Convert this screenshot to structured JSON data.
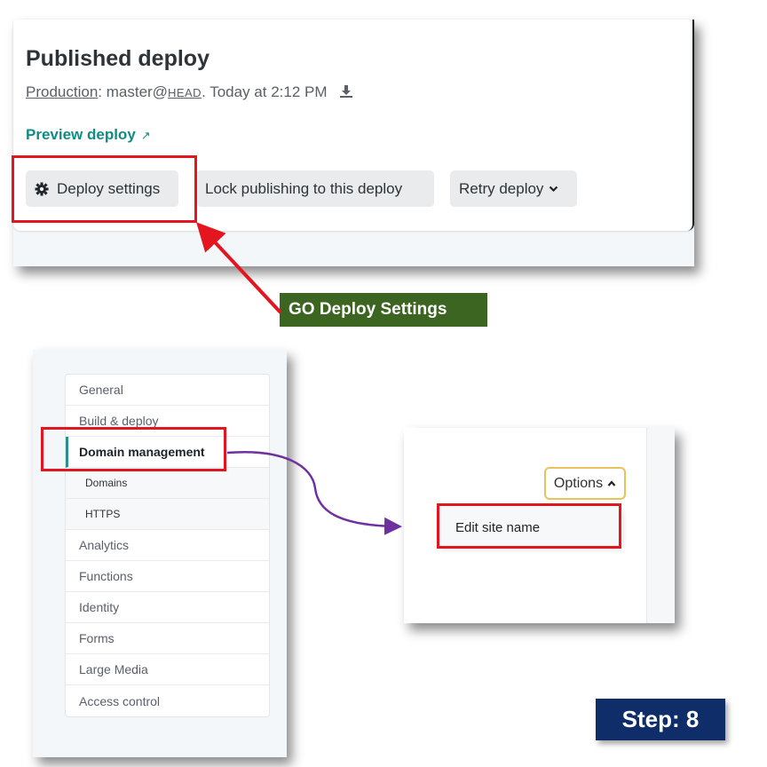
{
  "deploy": {
    "title": "Published deploy",
    "meta_prefix": "Production",
    "meta_branch": ": master@",
    "meta_head": "HEAD",
    "meta_time": ". Today at 2:12 PM",
    "preview_label": "Preview deploy",
    "preview_icon": "↗",
    "buttons": {
      "deploy_settings": "Deploy settings",
      "lock": "Lock publishing to this deploy",
      "retry": "Retry deploy"
    }
  },
  "annotation": {
    "go_label": "GO  Deploy Settings",
    "step_label": "Step: 8",
    "highlight_color": "#e3151e",
    "arrow_color_red": "#e3151e",
    "arrow_color_purple": "#7030a0"
  },
  "sidebar": {
    "items": [
      {
        "label": "General"
      },
      {
        "label": "Build & deploy"
      },
      {
        "label": "Domain management"
      },
      {
        "label": "Domains"
      },
      {
        "label": "HTTPS"
      },
      {
        "label": "Analytics"
      },
      {
        "label": "Functions"
      },
      {
        "label": "Identity"
      },
      {
        "label": "Forms"
      },
      {
        "label": "Large Media"
      },
      {
        "label": "Access control"
      }
    ]
  },
  "options": {
    "button_label": "Options",
    "menu_item": "Edit site name"
  },
  "colors": {
    "accent_teal": "#0f8c84",
    "go_label_bg": "#3d6522",
    "step_bg": "#0e2d69",
    "options_border": "#e8c25a"
  }
}
